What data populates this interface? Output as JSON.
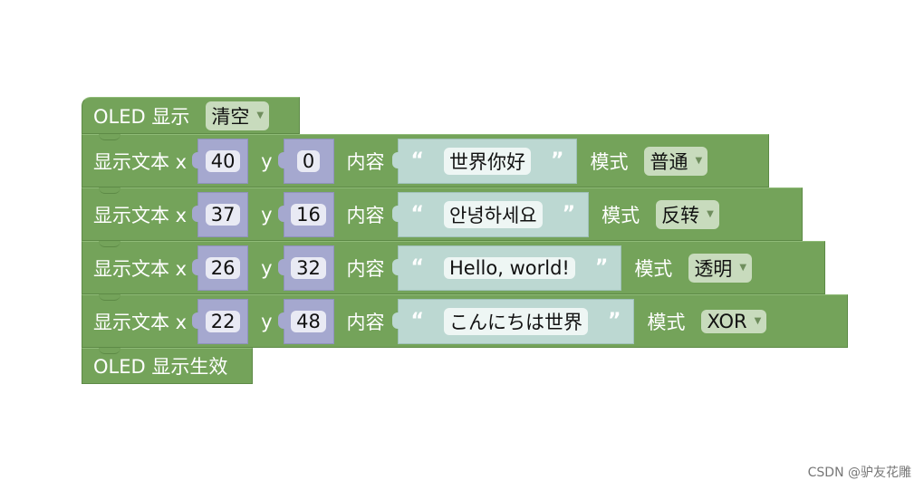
{
  "colors": {
    "statement_block": "#74a35a",
    "number_block": "#a5a8cf",
    "text_block": "#bcd8d2"
  },
  "clear_block": {
    "label": "OLED 显示",
    "dropdown": "清空"
  },
  "text_blocks": [
    {
      "label": "显示文本 x",
      "x": "40",
      "y_label": "y",
      "y": "0",
      "content_label": "内容",
      "open_quote": "“",
      "text": "世界你好",
      "close_quote": "”",
      "mode_label": "模式",
      "mode": "普通"
    },
    {
      "label": "显示文本 x",
      "x": "37",
      "y_label": "y",
      "y": "16",
      "content_label": "内容",
      "open_quote": "“",
      "text": "안녕하세요",
      "close_quote": "”",
      "mode_label": "模式",
      "mode": "反转"
    },
    {
      "label": "显示文本 x",
      "x": "26",
      "y_label": "y",
      "y": "32",
      "content_label": "内容",
      "open_quote": "“",
      "text": "Hello, world!",
      "close_quote": "”",
      "mode_label": "模式",
      "mode": "透明"
    },
    {
      "label": "显示文本 x",
      "x": "22",
      "y_label": "y",
      "y": "48",
      "content_label": "内容",
      "open_quote": "“",
      "text": "こんにちは世界",
      "close_quote": "”",
      "mode_label": "模式",
      "mode": "XOR"
    }
  ],
  "apply_block": {
    "label": "OLED 显示生效"
  },
  "watermark": "CSDN @驴友花雕"
}
